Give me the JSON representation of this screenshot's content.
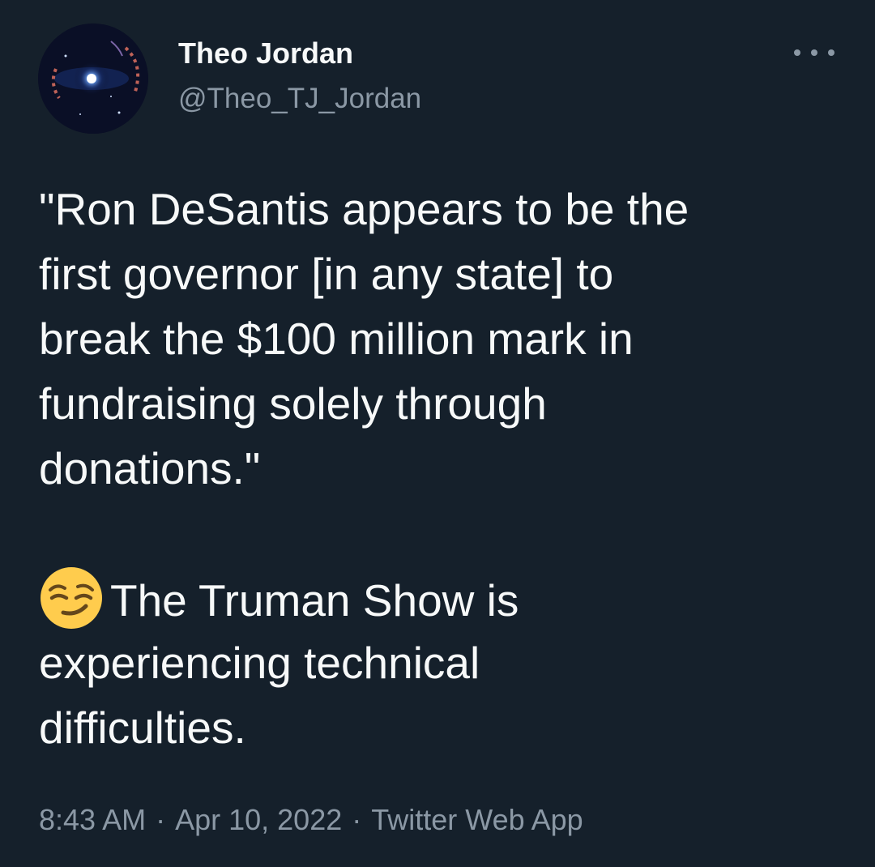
{
  "author": {
    "name": "Theo Jordan",
    "handle": "@Theo_TJ_Jordan"
  },
  "tweet": {
    "paragraph1_lines": [
      "\"Ron DeSantis appears to be the",
      "first governor [in any state] to",
      "break the $100 million mark in",
      "fundraising solely through",
      "donations.\""
    ],
    "paragraph2_first_line_text": "The Truman Show is",
    "paragraph2_lines": [
      "experiencing technical",
      "difficulties."
    ],
    "emoji": "smirking-face-icon"
  },
  "meta": {
    "time": "8:43 AM",
    "separator": "·",
    "date": "Apr 10, 2022",
    "source": "Twitter Web App"
  },
  "colors": {
    "background": "#15202b",
    "text_primary": "#f7f9f9",
    "text_secondary": "#8b98a5",
    "emoji_yellow": "#ffcc4d"
  }
}
